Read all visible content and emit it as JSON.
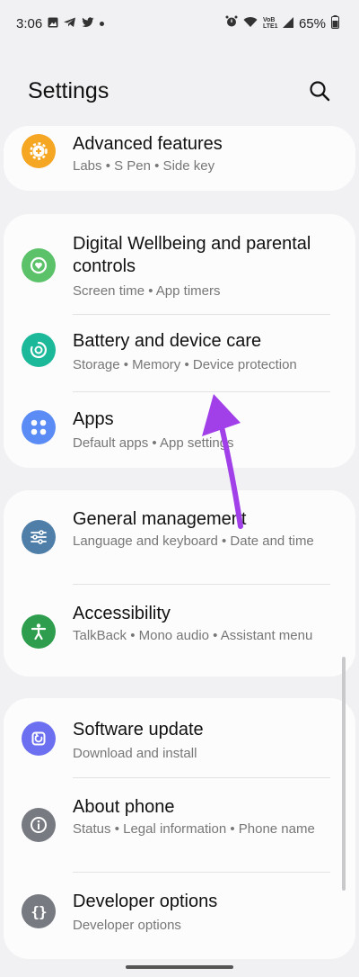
{
  "status_bar": {
    "time": "3:06",
    "battery": "65%",
    "icons_left": [
      "image-icon",
      "telegram-icon",
      "twitter-icon",
      "dot-icon"
    ],
    "icons_right": [
      "alarm-icon",
      "wifi-icon",
      "volte-icon",
      "signal-icon",
      "battery-icon"
    ],
    "volte_label": "VoB LTE1"
  },
  "header": {
    "title": "Settings",
    "search_icon": "search-icon"
  },
  "groups": [
    {
      "items": [
        {
          "title": "Advanced features",
          "subtitle": "Labs  •  S Pen  •  Side key",
          "icon": "gear-plus-icon",
          "color": "#f5a623"
        }
      ]
    },
    {
      "items": [
        {
          "title": "Digital Wellbeing and parental controls",
          "subtitle": "Screen time  •  App timers",
          "icon": "heart-circle-icon",
          "color": "#5cc26a"
        },
        {
          "title": "Battery and device care",
          "subtitle": "Storage  •  Memory  •  Device protection",
          "icon": "device-care-icon",
          "color": "#1bb89a"
        },
        {
          "title": "Apps",
          "subtitle": "Default apps  •  App settings",
          "icon": "apps-grid-icon",
          "color": "#5b8cf5"
        }
      ]
    },
    {
      "items": [
        {
          "title": "General management",
          "subtitle": "Language and keyboard  •  Date and time",
          "icon": "sliders-icon",
          "color": "#4f7fa8"
        },
        {
          "title": "Accessibility",
          "subtitle": "TalkBack  •  Mono audio  •  Assistant menu",
          "icon": "accessibility-icon",
          "color": "#2e9e4e"
        }
      ]
    },
    {
      "items": [
        {
          "title": "Software update",
          "subtitle": "Download and install",
          "icon": "software-update-icon",
          "color": "#6b6ff0"
        },
        {
          "title": "About phone",
          "subtitle": "Status  •  Legal information  •  Phone name",
          "icon": "info-icon",
          "color": "#777a80"
        },
        {
          "title": "Developer options",
          "subtitle": "Developer options",
          "icon": "braces-icon",
          "color": "#777a80"
        }
      ]
    }
  ],
  "annotation": {
    "arrow_color": "#a13fe8"
  }
}
